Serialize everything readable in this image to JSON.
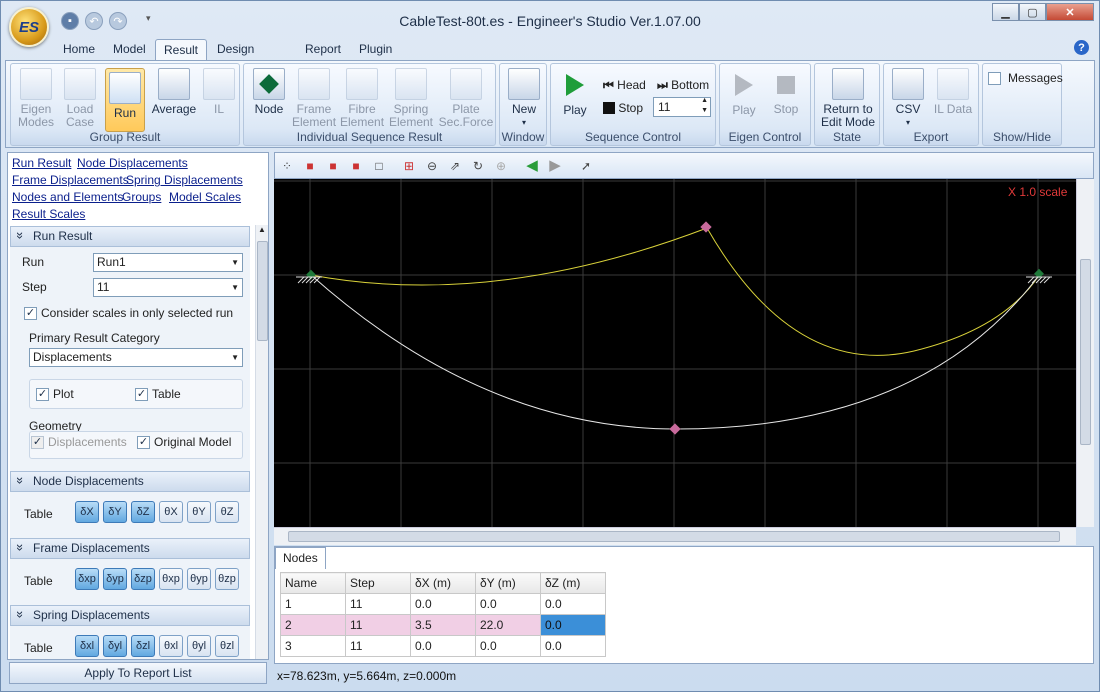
{
  "window": {
    "title": "CableTest-80t.es - Engineer's Studio Ver.1.07.00",
    "logo_text": "ES"
  },
  "menu": {
    "tabs": [
      {
        "label": "Home"
      },
      {
        "label": "Model"
      },
      {
        "label": "Result"
      },
      {
        "label": "Design Check"
      },
      {
        "label": "Report"
      },
      {
        "label": "Plugin"
      }
    ],
    "active": "Result"
  },
  "ribbon": {
    "groups": {
      "group_result": "Group Result",
      "individual": "Individual Sequence Result",
      "window": "Window",
      "sequence": "Sequence Control",
      "eigen": "Eigen Control",
      "state": "State",
      "export": "Export",
      "showhide": "Show/Hide"
    },
    "buttons": {
      "eigen_modes": "Eigen\nModes",
      "load_case": "Load\nCase",
      "run": "Run",
      "average": "Average",
      "il": "IL",
      "node": "Node",
      "frame_element": "Frame\nElement",
      "fibre_element": "Fibre\nElement",
      "spring_element": "Spring\nElement",
      "plate_force": "Plate\nSec.Force",
      "new": "New",
      "play": "Play",
      "head": "Head",
      "bottom": "Bottom",
      "stop": "Stop",
      "step_value": "11",
      "eigen_play": "Play",
      "eigen_stop": "Stop",
      "return_edit": "Return to\nEdit Mode",
      "csv": "CSV",
      "il_data": "IL Data",
      "messages": "Messages"
    }
  },
  "left": {
    "links": [
      "Run Result",
      "Node Displacements",
      "Frame Displacements",
      "Spring Displacements",
      "Nodes and Elements",
      "Groups",
      "Model Scales",
      "Result Scales"
    ],
    "run_result": {
      "header": "Run Result",
      "run_label": "Run",
      "run_value": "Run1",
      "step_label": "Step",
      "step_value": "11",
      "consider_scales": "Consider scales in only selected run",
      "primary_label": "Primary Result Category",
      "primary_value": "Displacements",
      "plot": "Plot",
      "table": "Table",
      "geometry": "Geometry",
      "geo_disp": "Displacements",
      "geo_orig": "Original Model"
    },
    "node_disp": {
      "header": "Node Displacements",
      "table": "Table",
      "buttons": [
        "δX",
        "δY",
        "δZ",
        "θX",
        "θY",
        "θZ"
      ]
    },
    "frame_disp": {
      "header": "Frame Displacements",
      "table": "Table",
      "buttons": [
        "δxp",
        "δyp",
        "δzp",
        "θxp",
        "θyp",
        "θzp"
      ]
    },
    "spring_disp": {
      "header": "Spring Displacements",
      "table": "Table",
      "buttons": [
        "δxl",
        "δyl",
        "δzl",
        "θxl",
        "θyl",
        "θzl"
      ]
    },
    "apply": "Apply To Report List"
  },
  "viewer": {
    "scale_label": "X 1.0 scale"
  },
  "nodes_panel": {
    "tab": "Nodes",
    "columns": [
      "Name",
      "Step",
      "δX (m)",
      "δY (m)",
      "δZ (m)"
    ],
    "rows": [
      [
        "1",
        "11",
        "0.0",
        "0.0",
        "0.0"
      ],
      [
        "2",
        "11",
        "3.5",
        "22.0",
        "0.0"
      ],
      [
        "3",
        "11",
        "0.0",
        "0.0",
        "0.0"
      ]
    ]
  },
  "status": {
    "coords": "x=78.623m, y=5.664m, z=0.000m"
  }
}
